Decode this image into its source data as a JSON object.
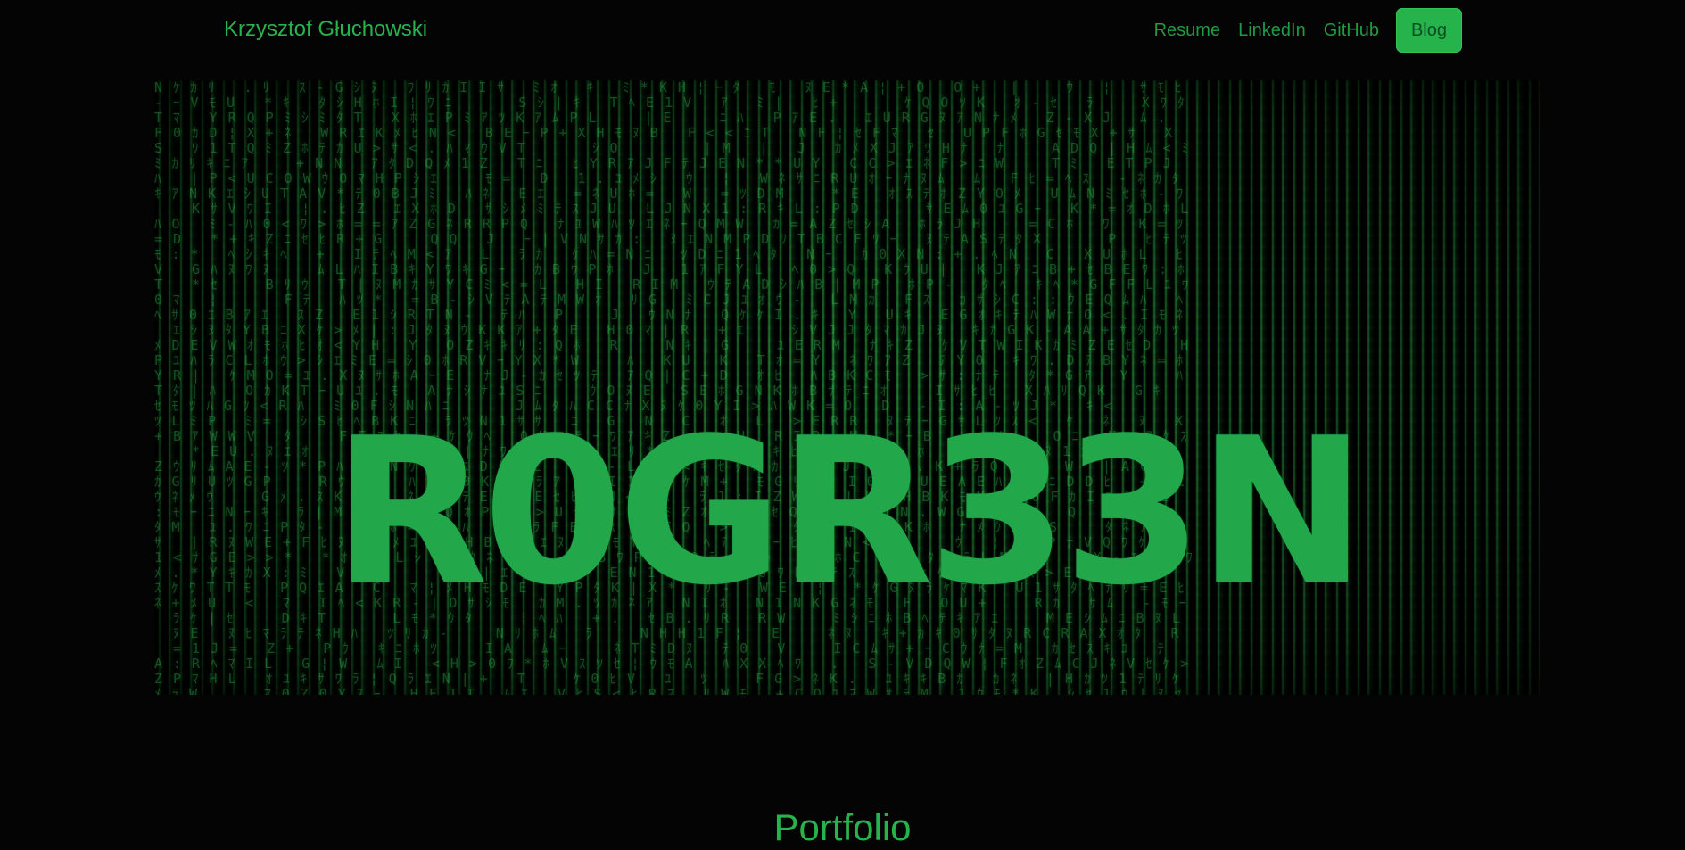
{
  "navbar": {
    "brand": "Krzysztof Głuchowski",
    "links": [
      {
        "label": "Resume"
      },
      {
        "label": "LinkedIn"
      },
      {
        "label": "GitHub"
      },
      {
        "label": "Blog"
      }
    ]
  },
  "hero": {
    "title": "R0GR33N",
    "background_icon": "matrix-code-background"
  },
  "main": {
    "section_title": "Portfolio"
  },
  "colors": {
    "background": "#040404",
    "accent": "#27b34b",
    "hero_title": "#22a84a"
  }
}
